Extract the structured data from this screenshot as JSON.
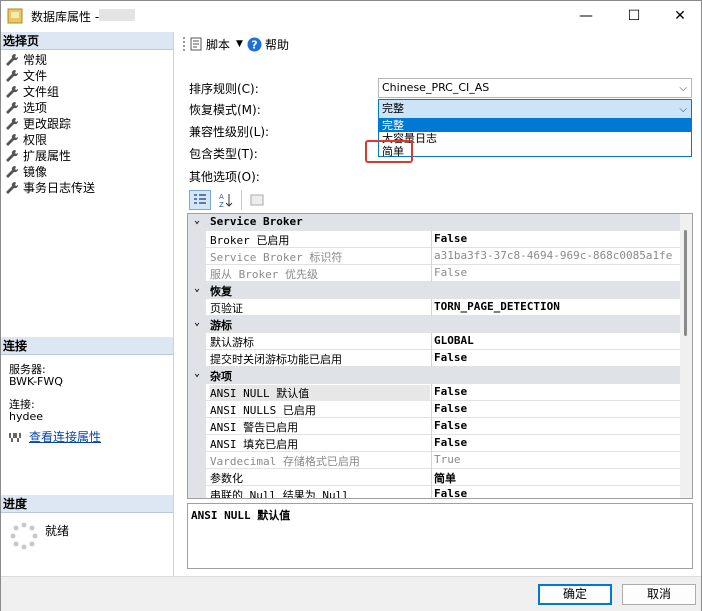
{
  "window": {
    "title": "数据库属性 -",
    "minimize": "—",
    "maximize": "☐",
    "close": "✕"
  },
  "left": {
    "select_page_header": "选择页",
    "pages": [
      {
        "label": "常规"
      },
      {
        "label": "文件"
      },
      {
        "label": "文件组"
      },
      {
        "label": "选项"
      },
      {
        "label": "更改跟踪"
      },
      {
        "label": "权限"
      },
      {
        "label": "扩展属性"
      },
      {
        "label": "镜像"
      },
      {
        "label": "事务日志传送"
      }
    ],
    "connection_header": "连接",
    "server_label": "服务器:",
    "server_value": "BWK-FWQ",
    "connection_label": "连接:",
    "connection_value": "hydee",
    "view_conn_props": "查看连接属性",
    "progress_header": "进度",
    "progress_status": "就绪"
  },
  "toolbar": {
    "script_label": "脚本",
    "help_label": "帮助"
  },
  "form": {
    "collation_label": "排序规则(C):",
    "collation_value": "Chinese_PRC_CI_AS",
    "recovery_label": "恢复模式(M):",
    "recovery_value": "完整",
    "recovery_options": [
      "完整",
      "大容量日志",
      "简单"
    ],
    "compat_label": "兼容性级别(L):",
    "containment_label": "包含类型(T):",
    "other_label": "其他选项(O):"
  },
  "grid": {
    "rows": [
      {
        "kind": "cat",
        "name": "Service Broker"
      },
      {
        "kind": "prop",
        "name": "Broker 已启用",
        "value": "False"
      },
      {
        "kind": "prop",
        "name": "Service Broker 标识符",
        "value": "a31ba3f3-37c8-4694-969c-868c0085a1fe",
        "disabled": true
      },
      {
        "kind": "prop",
        "name": "服从 Broker 优先级",
        "value": "False",
        "disabled": true
      },
      {
        "kind": "cat",
        "name": "恢复"
      },
      {
        "kind": "prop",
        "name": "页验证",
        "value": "TORN_PAGE_DETECTION"
      },
      {
        "kind": "cat",
        "name": "游标"
      },
      {
        "kind": "prop",
        "name": "默认游标",
        "value": "GLOBAL"
      },
      {
        "kind": "prop",
        "name": "提交时关闭游标功能已启用",
        "value": "False"
      },
      {
        "kind": "cat",
        "name": "杂项"
      },
      {
        "kind": "prop",
        "name": "ANSI NULL 默认值",
        "value": "False",
        "highlight": true
      },
      {
        "kind": "prop",
        "name": "ANSI NULLS 已启用",
        "value": "False"
      },
      {
        "kind": "prop",
        "name": "ANSI 警告已启用",
        "value": "False"
      },
      {
        "kind": "prop",
        "name": "ANSI 填充已启用",
        "value": "False"
      },
      {
        "kind": "prop",
        "name": "Vardecimal 存储格式已启用",
        "value": "True",
        "disabled": true
      },
      {
        "kind": "prop",
        "name": "参数化",
        "value": "简单"
      },
      {
        "kind": "prop",
        "name": "串联的 Null 结果为 Null",
        "value": "False"
      }
    ]
  },
  "description": "ANSI NULL 默认值",
  "buttons": {
    "ok": "确定",
    "cancel": "取消"
  }
}
